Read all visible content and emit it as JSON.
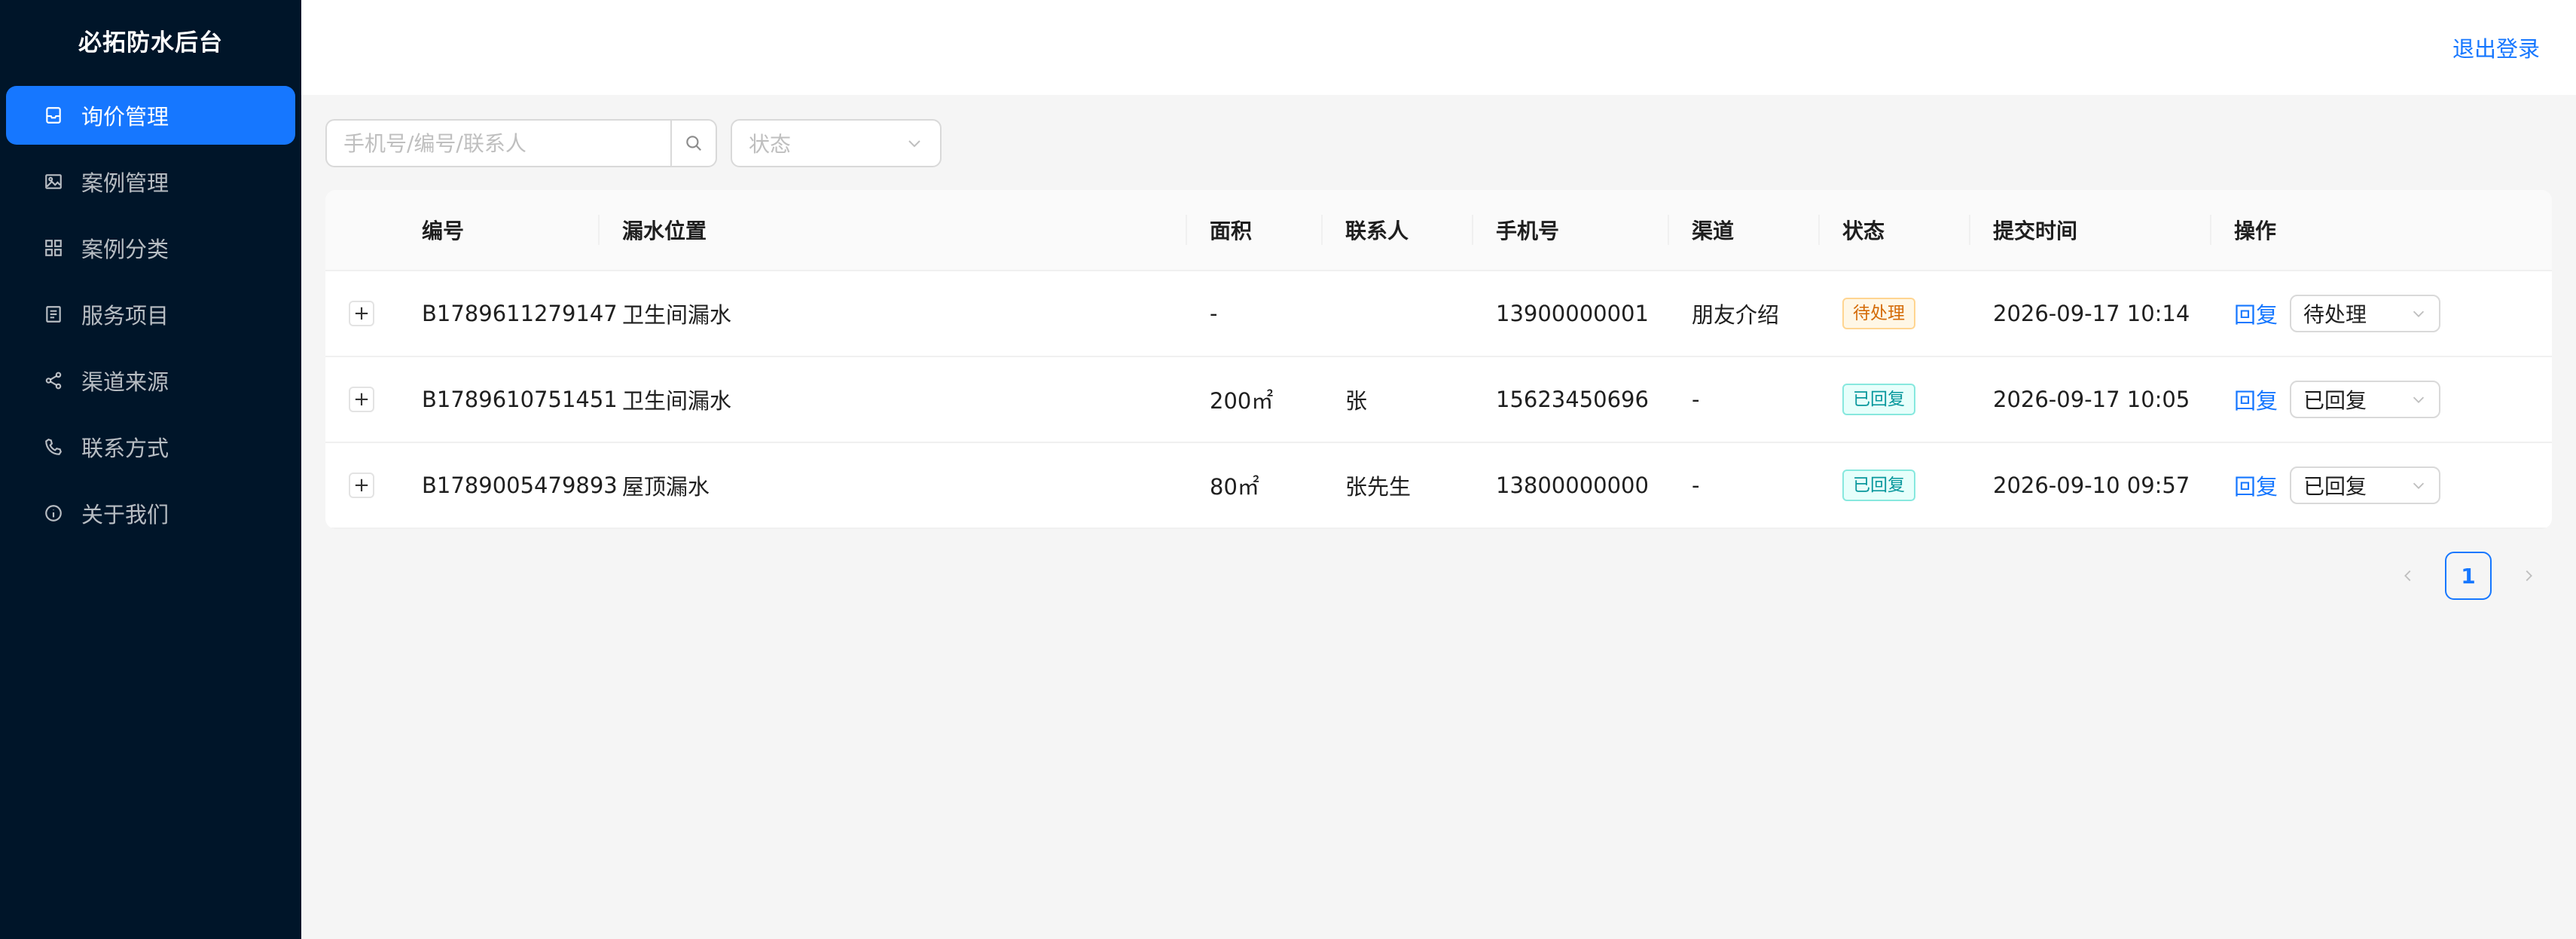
{
  "app": {
    "title": "必拓防水后台"
  },
  "sidebar": {
    "items": [
      {
        "label": "询价管理",
        "icon": "inbox-icon",
        "active": true
      },
      {
        "label": "案例管理",
        "icon": "picture-icon",
        "active": false
      },
      {
        "label": "案例分类",
        "icon": "appstore-icon",
        "active": false
      },
      {
        "label": "服务项目",
        "icon": "profile-icon",
        "active": false
      },
      {
        "label": "渠道来源",
        "icon": "share-icon",
        "active": false
      },
      {
        "label": "联系方式",
        "icon": "phone-icon",
        "active": false
      },
      {
        "label": "关于我们",
        "icon": "info-icon",
        "active": false
      }
    ]
  },
  "header": {
    "logout_label": "退出登录"
  },
  "filters": {
    "search_placeholder": "手机号/编号/联系人",
    "status_placeholder": "状态"
  },
  "table": {
    "headers": {
      "id": "编号",
      "location": "漏水位置",
      "area": "面积",
      "contact": "联系人",
      "phone": "手机号",
      "channel": "渠道",
      "status": "状态",
      "time": "提交时间",
      "op": "操作"
    },
    "rows": [
      {
        "id": "B1789611279147",
        "location": "卫生间漏水",
        "area": "-",
        "contact": "",
        "phone": "13900000001",
        "channel": "朋友介绍",
        "status": "待处理",
        "status_type": "pending",
        "time": "2026-09-17 10:14",
        "reply": "回复",
        "select": "待处理"
      },
      {
        "id": "B1789610751451",
        "location": "卫生间漏水",
        "area": "200㎡",
        "contact": "张",
        "phone": "15623450696",
        "channel": "-",
        "status": "已回复",
        "status_type": "replied",
        "time": "2026-09-17 10:05",
        "reply": "回复",
        "select": "已回复"
      },
      {
        "id": "B1789005479893",
        "location": "屋顶漏水",
        "area": "80㎡",
        "contact": "张先生",
        "phone": "13800000000",
        "channel": "-",
        "status": "已回复",
        "status_type": "replied",
        "time": "2026-09-10 09:57",
        "reply": "回复",
        "select": "已回复"
      }
    ]
  },
  "pagination": {
    "current": "1"
  },
  "colors": {
    "primary": "#1677ff",
    "sider_bg": "#001529",
    "pending": "#d46b08",
    "replied": "#08979c"
  }
}
